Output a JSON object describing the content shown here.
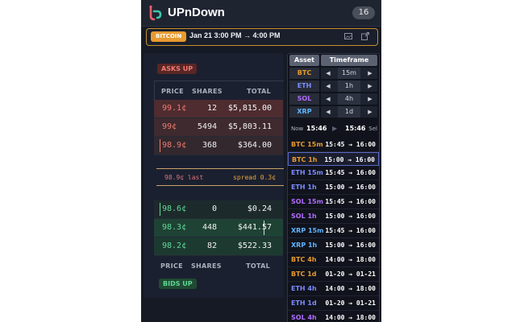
{
  "app": {
    "title": "UPnDown",
    "badge_count": "16"
  },
  "market_bar": {
    "asset": "BITCOIN",
    "time_range": "Jan 21 3:00 PM → 4:00 PM"
  },
  "orderbook": {
    "asks_label": "ASKS UP",
    "bids_label": "BIDS UP",
    "headers": {
      "price": "PRICE",
      "shares": "SHARES",
      "total": "TOTAL"
    },
    "asks": [
      {
        "price": "99.1¢",
        "shares": "12",
        "total": "$5,815.00"
      },
      {
        "price": "99¢",
        "shares": "5494",
        "total": "$5,803.11"
      },
      {
        "price": "98.9¢",
        "shares": "368",
        "total": "$364.00"
      }
    ],
    "last": "98.9¢ last",
    "spread": "spread 0.3¢",
    "bids": [
      {
        "price": "98.6¢",
        "shares": "0",
        "total": "$0.24"
      },
      {
        "price": "98.3¢",
        "shares": "448",
        "total": "$441.57"
      },
      {
        "price": "98.2¢",
        "shares": "82",
        "total": "$522.33"
      }
    ]
  },
  "selector": {
    "tab_asset": "Asset",
    "tab_timeframe": "Timeframe",
    "rows": [
      {
        "asset": "BTC",
        "color": "#e79a2f",
        "timeframe": "15m"
      },
      {
        "asset": "ETH",
        "color": "#7b8cff",
        "timeframe": "1h"
      },
      {
        "asset": "SOL",
        "color": "#b06cff",
        "timeframe": "4h"
      },
      {
        "asset": "XRP",
        "color": "#60b4ff",
        "timeframe": "1d"
      }
    ],
    "arrow_left": "◀",
    "arrow_right": "▶"
  },
  "now_bar": {
    "label": "Now",
    "time": "15:46",
    "play": "▶",
    "time2": "15:46",
    "sel": "Sel"
  },
  "markets": [
    {
      "name": "BTC 15m",
      "color": "#e79a2f",
      "range": "15:45 → 16:00"
    },
    {
      "name": "BTC 1h",
      "color": "#e79a2f",
      "range": "15:00 → 16:00"
    },
    {
      "name": "ETH 15m",
      "color": "#7b8cff",
      "range": "15:45 → 16:00"
    },
    {
      "name": "ETH 1h",
      "color": "#7b8cff",
      "range": "15:00 → 16:00"
    },
    {
      "name": "SOL 15m",
      "color": "#b06cff",
      "range": "15:45 → 16:00"
    },
    {
      "name": "SOL 1h",
      "color": "#b06cff",
      "range": "15:00 → 16:00"
    },
    {
      "name": "XRP 15m",
      "color": "#60b4ff",
      "range": "15:45 → 16:00"
    },
    {
      "name": "XRP 1h",
      "color": "#60b4ff",
      "range": "15:00 → 16:00"
    },
    {
      "name": "BTC 4h",
      "color": "#e79a2f",
      "range": "14:00 → 18:00"
    },
    {
      "name": "BTC 1d",
      "color": "#e79a2f",
      "range": "01-20 → 01-21"
    },
    {
      "name": "ETH 4h",
      "color": "#7b8cff",
      "range": "14:00 → 18:00"
    },
    {
      "name": "ETH 1d",
      "color": "#7b8cff",
      "range": "01-20 → 01-21"
    },
    {
      "name": "SOL 4h",
      "color": "#b06cff",
      "range": "14:00 → 18:00"
    }
  ],
  "colors": {
    "accent": "#e79a2f",
    "ask": "#ee7b6e",
    "bid": "#62d99a",
    "spread": "#e9a53a",
    "selected_border": "#5b67c6"
  },
  "icons": {
    "logo": "upndown-logo-icon",
    "image": "image-icon",
    "external": "external-link-icon"
  }
}
